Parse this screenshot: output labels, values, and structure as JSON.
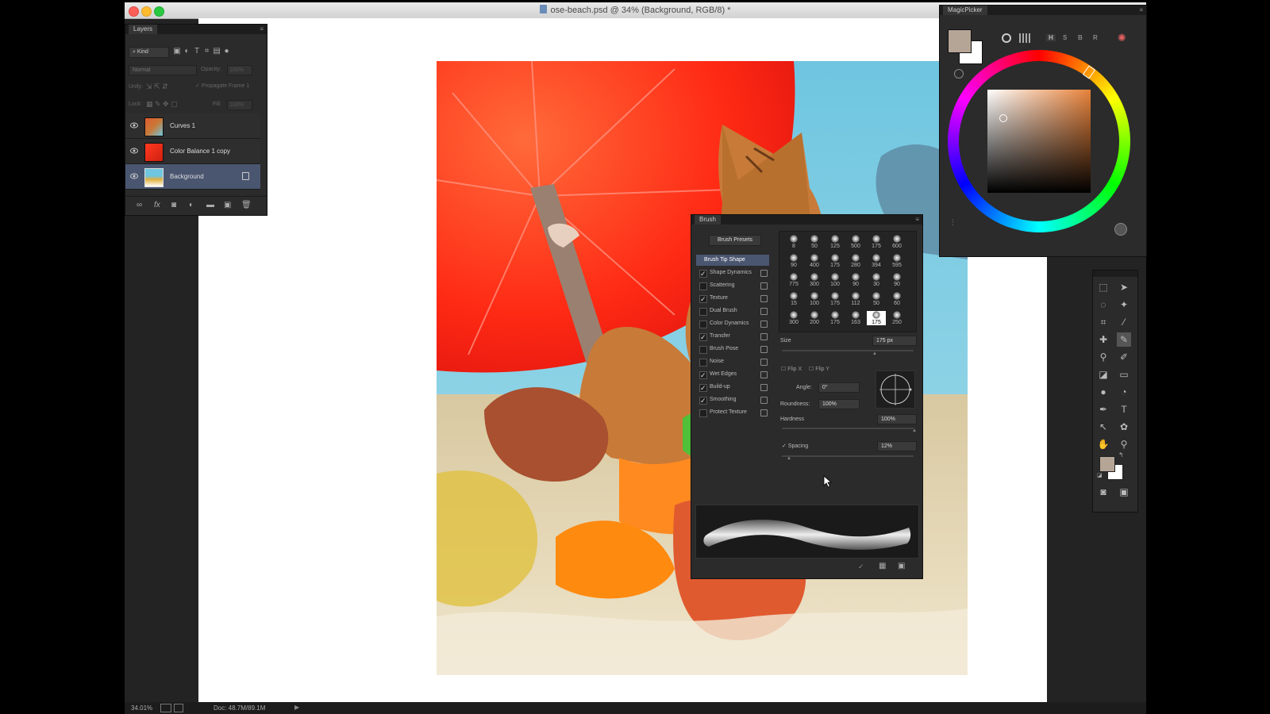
{
  "window": {
    "title": "ose-beach.psd @ 34% (Background, RGB/8) *"
  },
  "layers_panel": {
    "tab": "Layers",
    "filter_kind": "Kind",
    "blend_mode": "Normal",
    "opacity_label": "Opacity:",
    "opacity_value": "100%",
    "unify_label": "Unify:",
    "propagate_label": "Propagate Frame 1",
    "lock_label": "Lock:",
    "fill_label": "Fill:",
    "fill_value": "100%",
    "layers": [
      {
        "name": "Curves 1"
      },
      {
        "name": "Color Balance 1 copy"
      },
      {
        "name": "Background"
      }
    ]
  },
  "magicpicker": {
    "tab": "MagicPicker",
    "modes": [
      "H",
      "S",
      "B",
      "R"
    ],
    "foreground_color": "#b5a597",
    "background_color": "#ffffff",
    "hue_color": "#e8823a"
  },
  "brush_panel": {
    "tab": "Brush",
    "presets_button": "Brush Presets",
    "options": [
      {
        "label": "Brush Tip Shape",
        "checked": null,
        "active": true
      },
      {
        "label": "Shape Dynamics",
        "checked": true
      },
      {
        "label": "Scattering",
        "checked": false
      },
      {
        "label": "Texture",
        "checked": true
      },
      {
        "label": "Dual Brush",
        "checked": false
      },
      {
        "label": "Color Dynamics",
        "checked": false
      },
      {
        "label": "Transfer",
        "checked": true
      },
      {
        "label": "Brush Pose",
        "checked": false
      },
      {
        "label": "Noise",
        "checked": false
      },
      {
        "label": "Wet Edges",
        "checked": true
      },
      {
        "label": "Build-up",
        "checked": true
      },
      {
        "label": "Smoothing",
        "checked": true
      },
      {
        "label": "Protect Texture",
        "checked": false
      }
    ],
    "tip_sizes": [
      [
        "8",
        "50",
        "125",
        "500",
        "175",
        "600"
      ],
      [
        "90",
        "400",
        "175",
        "280",
        "394",
        "595"
      ],
      [
        "775",
        "300",
        "100",
        "90",
        "30",
        "90"
      ],
      [
        "15",
        "100",
        "175",
        "112",
        "50",
        "60"
      ],
      [
        "300",
        "200",
        "175",
        "163",
        "175",
        "250"
      ]
    ],
    "size_label": "Size",
    "size_value": "175 px",
    "flip_x": "Flip X",
    "flip_y": "Flip Y",
    "angle_label": "Angle:",
    "angle_value": "0°",
    "roundness_label": "Roundness:",
    "roundness_value": "100%",
    "hardness_label": "Hardness",
    "hardness_value": "100%",
    "spacing_label": "Spacing",
    "spacing_value": "12%"
  },
  "status": {
    "zoom": "34.01%",
    "doc": "Doc: 48.7M/89.1M"
  },
  "colors": {
    "panel_bg": "#2b2b2b",
    "app_bg": "#232323",
    "selection": "#4a5670"
  }
}
